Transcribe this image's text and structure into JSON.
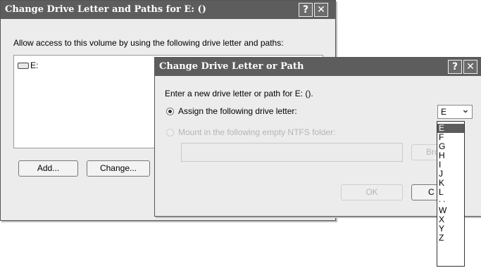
{
  "outer_dialog": {
    "title": "Change Drive Letter and Paths for E: ()",
    "help_glyph": "?",
    "close_glyph": "✕",
    "instruction": "Allow access to this volume by using the following drive letter and paths:",
    "list_items": [
      {
        "icon": "drive-icon",
        "label": "E:"
      }
    ],
    "buttons": {
      "add": "Add...",
      "change": "Change..."
    }
  },
  "inner_dialog": {
    "title": "Change Drive Letter or Path",
    "help_glyph": "?",
    "close_glyph": "✕",
    "prompt": "Enter a new drive letter or path for E: ().",
    "option_assign": "Assign the following drive letter:",
    "option_mount": "Mount in the following empty NTFS folder:",
    "browse_visible": "Bro",
    "ok": "OK",
    "cancel_visible": "C",
    "drive_select": {
      "value": "E",
      "arrow": "⌄",
      "options": [
        "E",
        "F",
        "G",
        "H",
        "I",
        "J",
        "K",
        "L",
        ". .",
        "W",
        "X",
        "Y",
        "Z"
      ],
      "selected": "E"
    }
  }
}
